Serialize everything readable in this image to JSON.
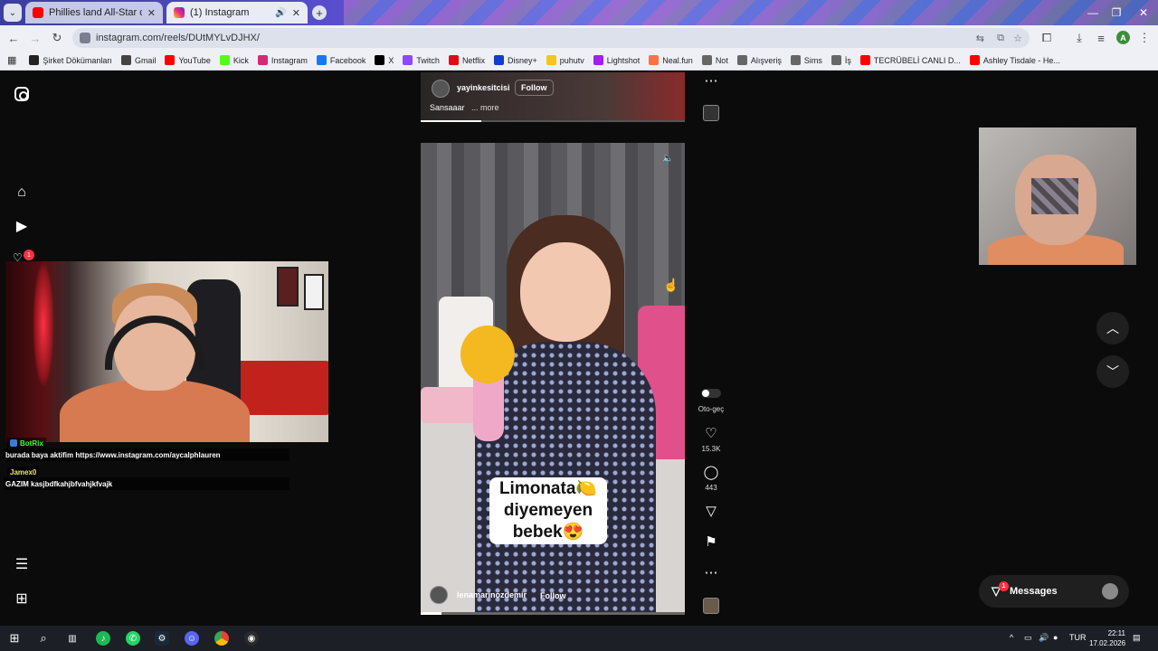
{
  "tabs": [
    {
      "title": "Phillies land All-Star closer Jhoa",
      "favicon_color": "#ff0000",
      "active": false
    },
    {
      "title": "(1) Instagram",
      "favicon_color": "#d62976",
      "active": true
    }
  ],
  "browser": {
    "url": "instagram.com/reels/DUtMYLvDJHX/",
    "profile_initial": "A"
  },
  "bookmarks": [
    {
      "label": "Şirket Dökümanları",
      "color": "#222222"
    },
    {
      "label": "Gmail",
      "color": "#444444"
    },
    {
      "label": "YouTube",
      "color": "#ff0000"
    },
    {
      "label": "Kick",
      "color": "#53fc18"
    },
    {
      "label": "Instagram",
      "color": "#d62976"
    },
    {
      "label": "Facebook",
      "color": "#1877f2"
    },
    {
      "label": "X",
      "color": "#000000"
    },
    {
      "label": "Twitch",
      "color": "#9146ff"
    },
    {
      "label": "Netflix",
      "color": "#e50914"
    },
    {
      "label": "Disney+",
      "color": "#113ccf"
    },
    {
      "label": "puhutv",
      "color": "#f5c518"
    },
    {
      "label": "Lightshot",
      "color": "#a020f0"
    },
    {
      "label": "Neal.fun",
      "color": "#ff7043"
    },
    {
      "label": "Not",
      "color": "#666666"
    },
    {
      "label": "Alışveriş",
      "color": "#666666"
    },
    {
      "label": "Sims",
      "color": "#666666"
    },
    {
      "label": "İş",
      "color": "#666666"
    },
    {
      "label": "TECRÜBELİ CANLI D...",
      "color": "#ff0000"
    },
    {
      "label": "Ashley Tisdale - He...",
      "color": "#ff0000"
    }
  ],
  "sidebar": {
    "notification_count": "1"
  },
  "chat": [
    {
      "user": "BotRix",
      "user_color": "#3cff3c",
      "message": "burada baya aktifim https://www.instagram.com/aycalphlauren"
    },
    {
      "user": "Jamex0",
      "user_color": "#e8e86a",
      "message": "GAZIM kasjbdfkahjbfvahjkfvajk"
    }
  ],
  "reel_top": {
    "username": "yayinkesitcisi",
    "follow_label": "Follow",
    "caption": "Sansaaar",
    "more_label": "... more",
    "progress": 0.23
  },
  "reel_main": {
    "caption_lines": [
      "Limonata🍋",
      "diyemeyen",
      "bebek😍"
    ],
    "username": "lenamarinozdemir",
    "follow_label": "Follow",
    "progress": 0.08
  },
  "actions": {
    "autoplay_label": "Oto-geç",
    "likes": "15.3K",
    "comments": "443"
  },
  "messages": {
    "label": "Messages",
    "badge": "1"
  },
  "taskbar": {
    "language": "TUR",
    "time": "22:11",
    "date": "17.02.2026"
  }
}
